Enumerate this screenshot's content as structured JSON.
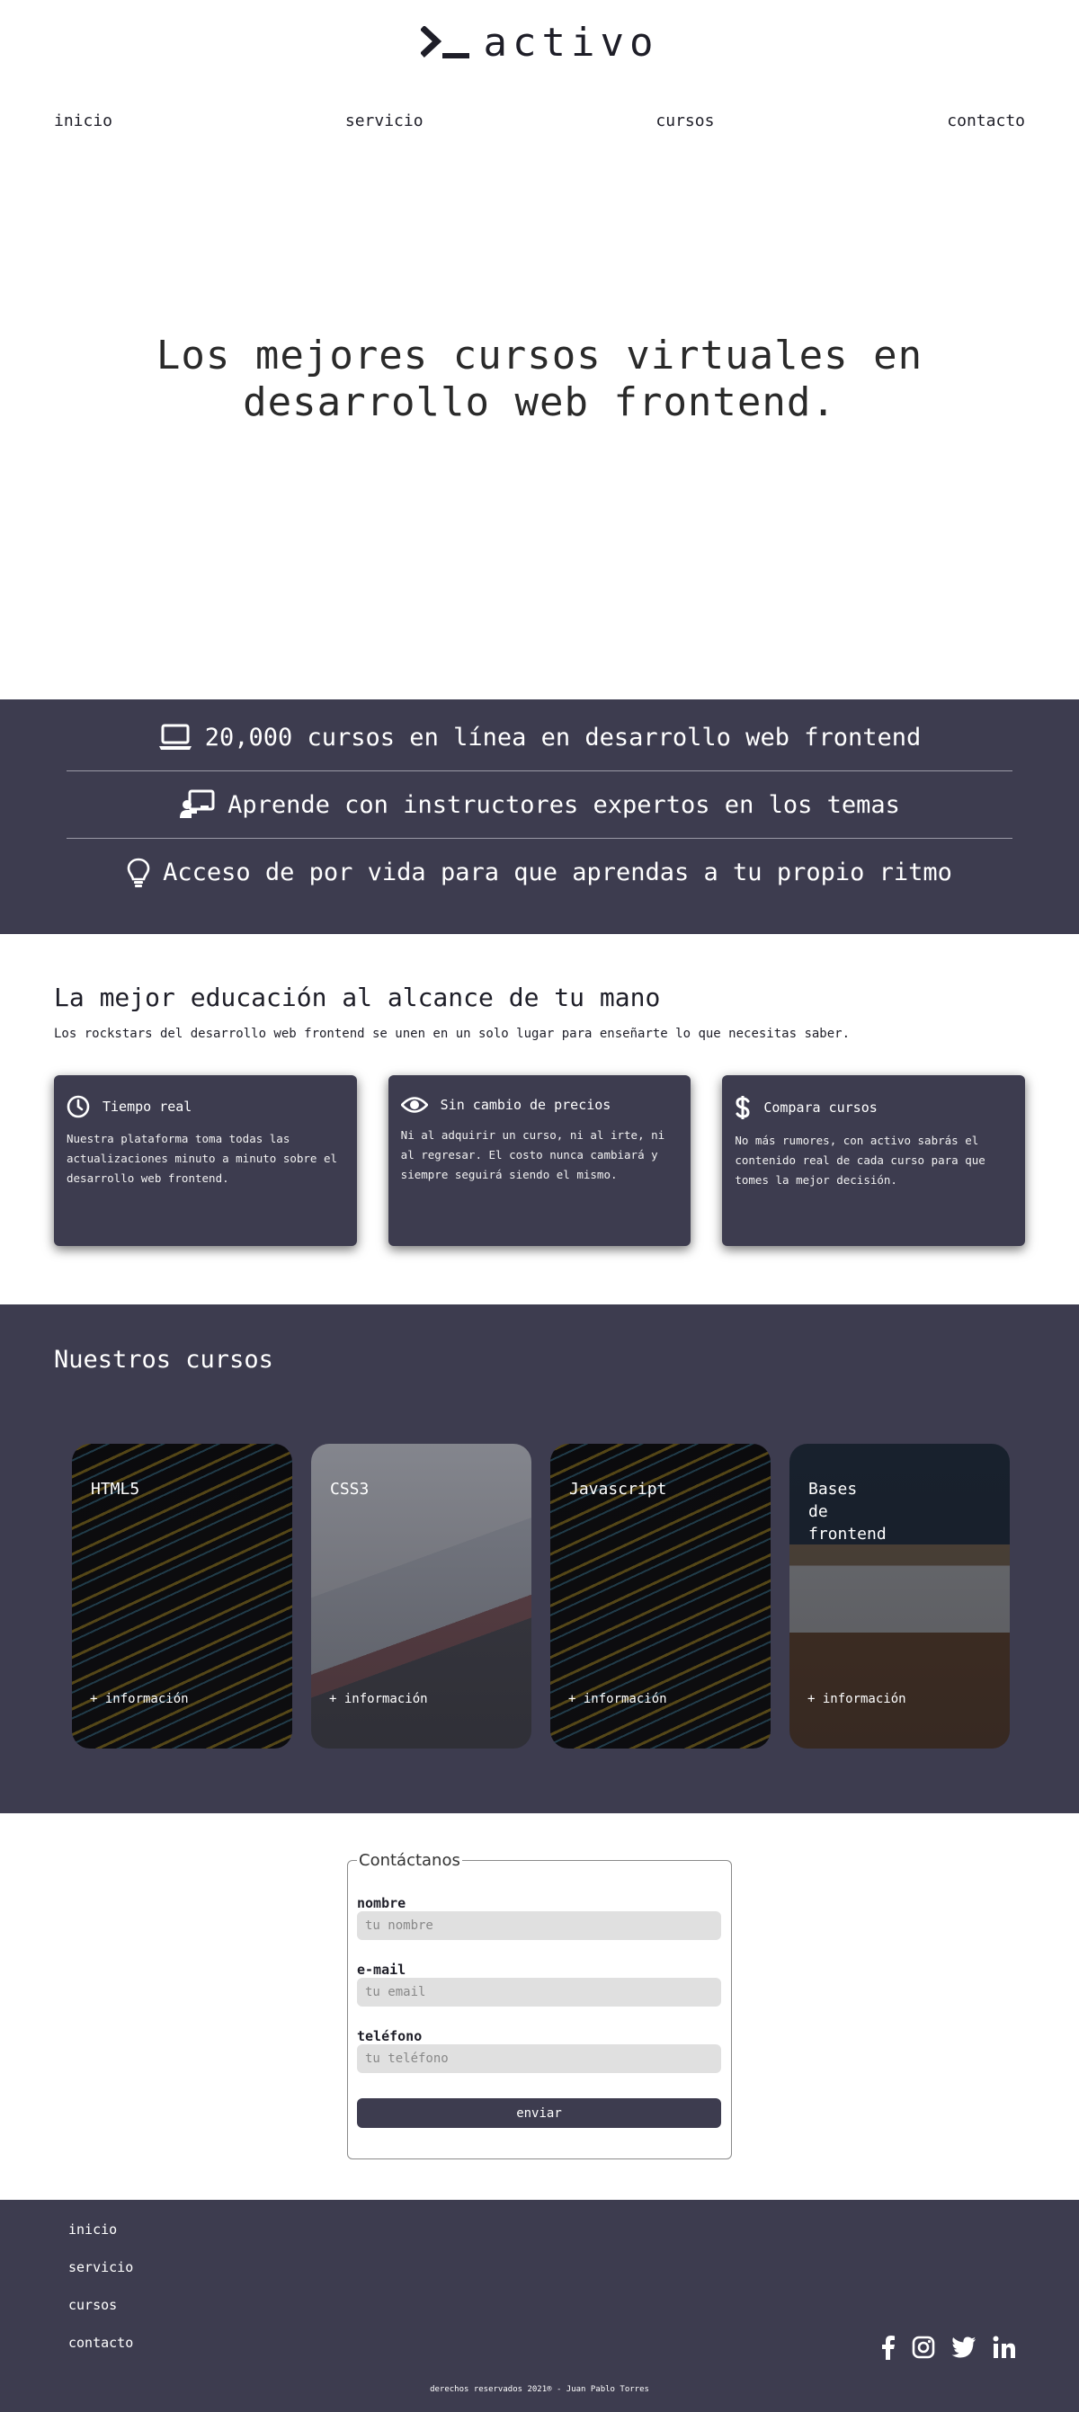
{
  "header": {
    "logo_text": "activo",
    "nav": [
      "inicio",
      "servicio",
      "cursos",
      "contacto"
    ]
  },
  "hero": {
    "title": "Los mejores cursos virtuales en desarrollo web frontend."
  },
  "features": [
    {
      "icon": "laptop-icon",
      "text": "20,000 cursos en línea en desarrollo web frontend"
    },
    {
      "icon": "instructor-icon",
      "text": "Aprende con instructores expertos en los temas"
    },
    {
      "icon": "lightbulb-icon",
      "text": "Acceso de por vida para que aprendas a tu propio ritmo"
    }
  ],
  "education": {
    "title": "La mejor educación al alcance de tu mano",
    "subtitle": "Los rockstars del desarrollo web frontend se unen en un solo lugar para enseñarte lo que necesitas saber.",
    "cards": [
      {
        "icon": "clock-icon",
        "title": "Tiempo real",
        "text": "Nuestra plataforma toma todas las actualizaciones minuto a minuto sobre el desarrollo web frontend."
      },
      {
        "icon": "eye-icon",
        "title": "Sin cambio de precios",
        "text": "Ni al adquirir un curso, ni al irte, ni al regresar. El costo nunca cambiará y siempre seguirá siendo el mismo."
      },
      {
        "icon": "dollar-icon",
        "title": "Compara cursos",
        "text": "No más rumores, con activo sabrás el contenido real de cada curso para que tomes la mejor decisión."
      }
    ]
  },
  "courses": {
    "title": "Nuestros cursos",
    "items": [
      {
        "title": "HTML5",
        "more": "+ información"
      },
      {
        "title": "CSS3",
        "more": "+ información"
      },
      {
        "title": "Javascript",
        "more": "+ información"
      },
      {
        "title": "Bases\nde\nfrontend",
        "more": "+ información"
      }
    ]
  },
  "contact": {
    "legend": "Contáctanos",
    "fields": [
      {
        "label": "nombre",
        "placeholder": "tu nombre"
      },
      {
        "label": "e-mail",
        "placeholder": "tu email"
      },
      {
        "label": "teléfono",
        "placeholder": "tu teléfono"
      }
    ],
    "submit": "enviar"
  },
  "footer": {
    "nav": [
      "inicio",
      "servicio",
      "cursos",
      "contacto"
    ],
    "social": [
      "facebook-icon",
      "instagram-icon",
      "twitter-icon",
      "linkedin-icon"
    ],
    "copyright": "derechos reservados 2021® - Juan Pablo Torres"
  },
  "colors": {
    "accent": "#3d3c4f",
    "text": "#1e1e28",
    "input_bg": "#e0e0e0"
  }
}
